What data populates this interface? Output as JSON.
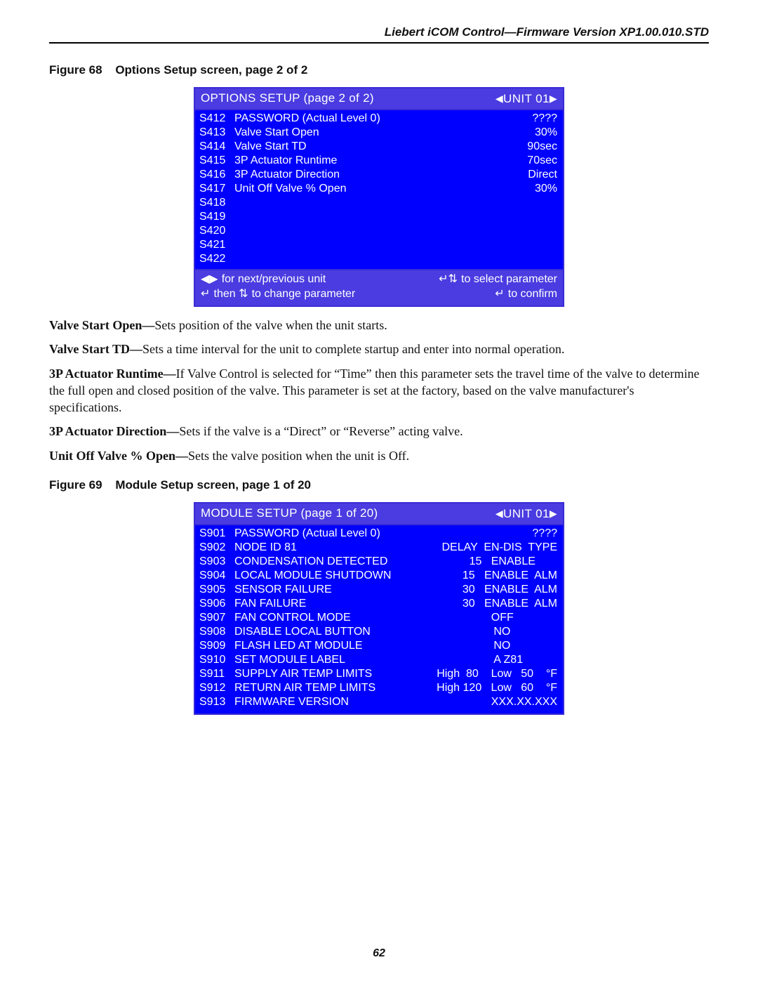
{
  "header": {
    "running": "Liebert iCOM Control—Firmware Version XP1.00.010.STD"
  },
  "fig68": {
    "label": "Figure 68",
    "caption": "Options Setup screen, page 2 of 2",
    "screen": {
      "title": "OPTIONS SETUP (page 2 of 2)",
      "unit": "UNIT 01",
      "rows": [
        {
          "code": "S412",
          "label": "PASSWORD   (Actual Level  0)",
          "value": "????"
        },
        {
          "code": "S413",
          "label": "Valve Start Open",
          "value": "30%"
        },
        {
          "code": "S414",
          "label": "Valve Start TD",
          "value": "90sec"
        },
        {
          "code": "S415",
          "label": "3P Actuator Runtime",
          "value": "70sec"
        },
        {
          "code": "S416",
          "label": "3P Actuator Direction",
          "value": "Direct"
        },
        {
          "code": "S417",
          "label": "Unit Off Valve % Open",
          "value": "30%"
        },
        {
          "code": "S418",
          "label": "",
          "value": ""
        },
        {
          "code": "S419",
          "label": "",
          "value": ""
        },
        {
          "code": "S420",
          "label": "",
          "value": ""
        },
        {
          "code": "S421",
          "label": "",
          "value": ""
        },
        {
          "code": "S422",
          "label": "",
          "value": ""
        }
      ],
      "foot": {
        "l1_left": "for next/previous unit",
        "l1_right": "to select parameter",
        "l2_left_a": "then",
        "l2_left_b": "to change parameter",
        "l2_right": "to confirm"
      }
    }
  },
  "descriptions": [
    {
      "term": "Valve Start Open—",
      "text": "Sets position of the valve when the unit starts."
    },
    {
      "term": "Valve Start TD—",
      "text": "Sets a time interval for the unit to complete startup and enter into normal operation."
    },
    {
      "term": "3P Actuator Runtime—",
      "text": "If Valve Control is selected for “Time” then this parameter sets the travel time of the valve to determine the full open and closed position of the valve. This parameter is set at the factory, based on the valve manufacturer's specifications."
    },
    {
      "term": "3P Actuator Direction—",
      "text": "Sets if the valve is a “Direct” or “Reverse” acting valve."
    },
    {
      "term": "Unit Off Valve % Open—",
      "text": "Sets the valve position when the unit is Off."
    }
  ],
  "fig69": {
    "label": "Figure 69",
    "caption": "Module Setup screen, page 1 of 20",
    "screen": {
      "title": "MODULE SETUP (page 1 of 20)",
      "unit": "UNIT 01",
      "header_right": "DELAY  EN-DIS  TYPE",
      "rows": [
        {
          "code": "S901",
          "label": "PASSWORD   (Actual Level  0)",
          "value": "????"
        },
        {
          "code": "S902",
          "label": "NODE ID 81",
          "value": "DELAY  EN-DIS  TYPE"
        },
        {
          "code": "S903",
          "label": "CONDENSATION DETECTED",
          "value": "15   ENABLE       "
        },
        {
          "code": "S904",
          "label": "LOCAL MODULE SHUTDOWN",
          "value": "15   ENABLE  ALM"
        },
        {
          "code": "S905",
          "label": "SENSOR FAILURE",
          "value": "30   ENABLE  ALM"
        },
        {
          "code": "S906",
          "label": "FAN FAILURE",
          "value": "30   ENABLE  ALM"
        },
        {
          "code": "S907",
          "label": "FAN CONTROL MODE",
          "value": "OFF              "
        },
        {
          "code": "S908",
          "label": "DISABLE LOCAL BUTTON",
          "value": "NO               "
        },
        {
          "code": "S909",
          "label": "FLASH LED AT MODULE",
          "value": "NO               "
        },
        {
          "code": "S910",
          "label": "SET MODULE LABEL",
          "value": "A Z81           "
        },
        {
          "code": "S911",
          "label": "SUPPLY AIR TEMP LIMITS",
          "value": "High  80    Low   50    °F"
        },
        {
          "code": "S912",
          "label": "RETURN AIR TEMP LIMITS",
          "value": "High 120   Low   60    °F"
        },
        {
          "code": "S913",
          "label": "FIRMWARE VERSION",
          "value": "XXX.XX.XXX"
        }
      ]
    }
  },
  "pagenum": "62"
}
